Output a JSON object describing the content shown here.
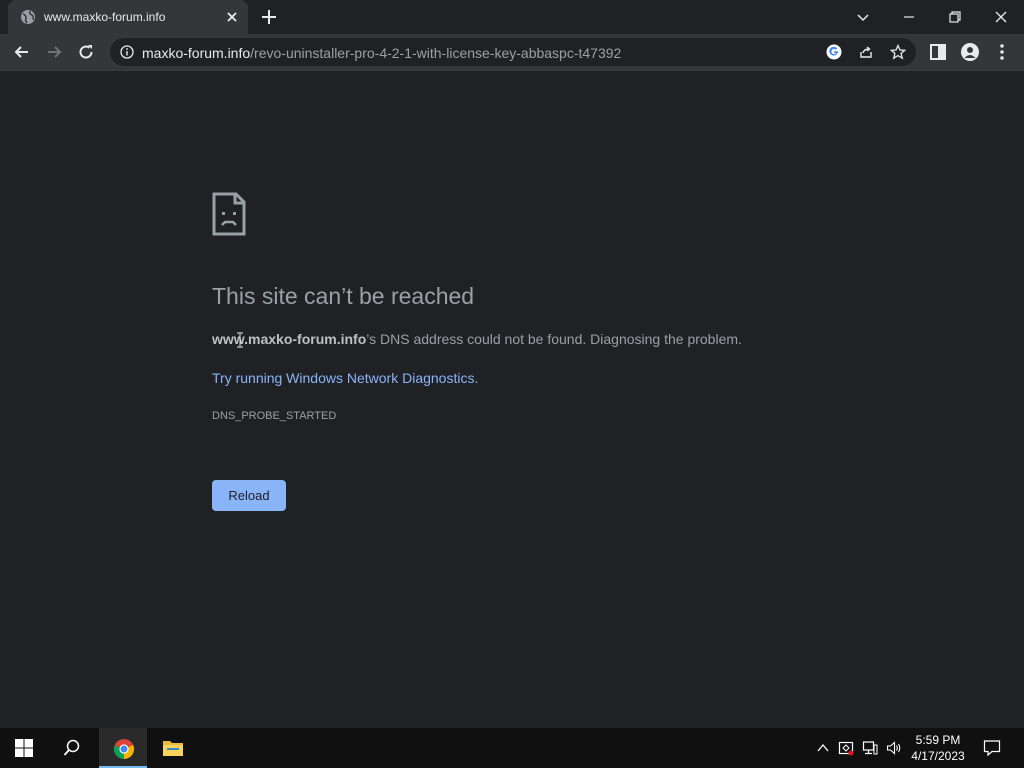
{
  "browser": {
    "tab": {
      "title": "www.maxko-forum.info",
      "favicon": "globe-icon"
    },
    "address": {
      "host": "maxko-forum.info",
      "path": "/revo-uninstaller-pro-4-2-1-with-license-key-abbaspc-t47392"
    }
  },
  "error_page": {
    "icon": "sad-page-icon",
    "heading": "This site can’t be reached",
    "message_host": "www.maxko-forum.info",
    "message_rest": "’s DNS address could not be found. Diagnosing the problem.",
    "diagnostics_link": "Try running Windows Network Diagnostics.",
    "error_code": "DNS_PROBE_STARTED",
    "reload_label": "Reload"
  },
  "taskbar": {
    "time": "5:59 PM",
    "date": "4/17/2023"
  },
  "colors": {
    "page_bg": "#202124",
    "toolbar_bg": "#35363a",
    "link": "#8ab4f8",
    "button": "#8ab4f8"
  }
}
